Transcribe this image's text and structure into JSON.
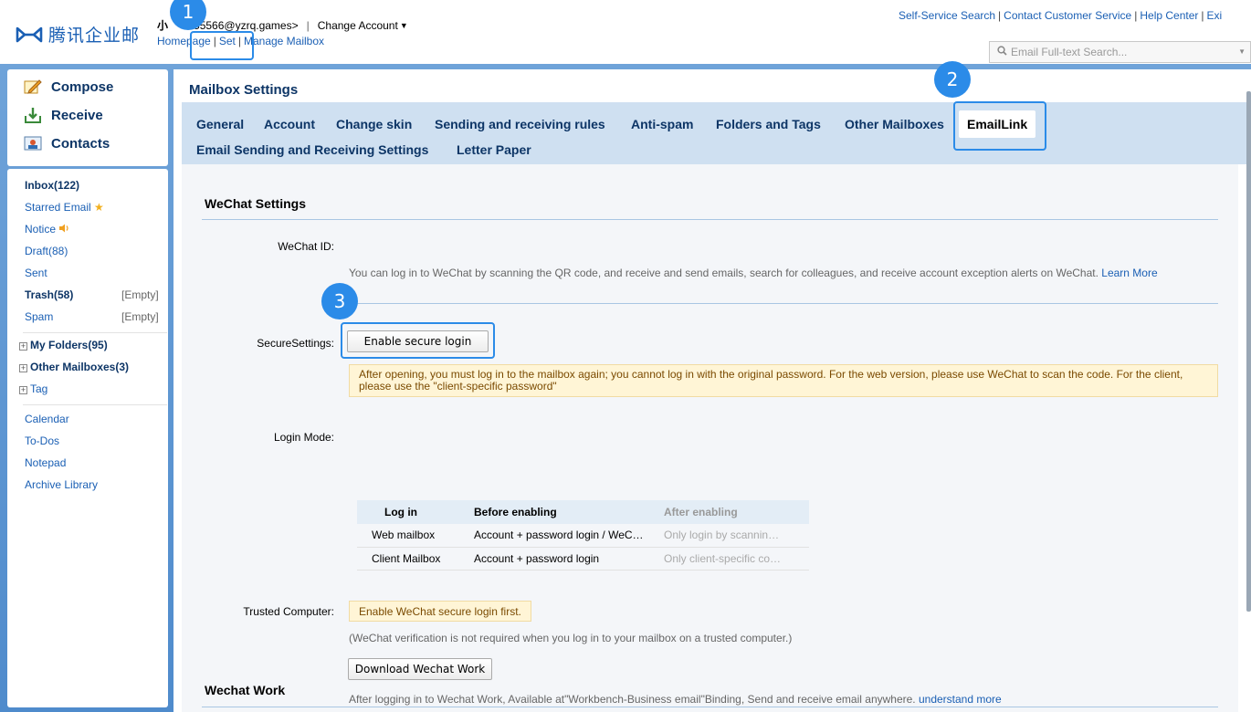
{
  "header": {
    "logo_text": "腾讯企业邮",
    "username": "小",
    "email": "55566@yzrq.games>",
    "change_account": "Change Account",
    "nav": [
      "Homepage",
      "Set",
      "Manage Mailbox"
    ],
    "top_links": [
      "Self-Service Search",
      "Contact Customer Service",
      "Help Center",
      "Exi"
    ],
    "search_placeholder": "Email Full-text Search..."
  },
  "sidebar": {
    "actions": [
      {
        "label": "Compose",
        "icon": "compose-icon"
      },
      {
        "label": "Receive",
        "icon": "receive-icon"
      },
      {
        "label": "Contacts",
        "icon": "contacts-icon"
      }
    ],
    "folders": [
      {
        "label": "Inbox(122)"
      },
      {
        "label": "Starred Email"
      },
      {
        "label": "Notice"
      },
      {
        "label": "Draft(88)"
      },
      {
        "label": "Sent"
      },
      {
        "label": "Trash(58)",
        "extra": "[Empty]"
      },
      {
        "label": "Spam",
        "extra": "[Empty]"
      }
    ],
    "groups": [
      "My Folders(95)",
      "Other Mailboxes(3)",
      "Tag"
    ],
    "tools": [
      "Calendar",
      "To-Dos",
      "Notepad",
      "Archive Library"
    ]
  },
  "main": {
    "title": "Mailbox Settings",
    "tabs_row1": [
      "General",
      "Account",
      "Change skin",
      "Sending and receiving rules",
      "Anti-spam",
      "Folders and Tags",
      "Other Mailboxes",
      "EmailLink"
    ],
    "tabs_row2": [
      "Email Sending and Receiving Settings",
      "Letter Paper"
    ],
    "active_tab": "EmailLink"
  },
  "wechat": {
    "heading": "WeChat Settings",
    "id_label": "WeChat ID:",
    "id_desc": "You can log in to WeChat by scanning the QR code, and receive and send emails, search for colleagues, and receive account exception alerts on WeChat.",
    "learn_more": "Learn More",
    "secure_label": "SecureSettings:",
    "secure_button": "Enable secure login",
    "secure_notice": "After opening, you must log in to the mailbox again; you cannot log in with the original password. For the web version, please use WeChat to scan the code. For the client, please use the \"client-specific password\"",
    "login_mode_label": "Login Mode:",
    "login_table": {
      "headers": [
        "Log in",
        "Before enabling",
        "After enabling"
      ],
      "rows": [
        [
          "Web mailbox",
          "Account + password login / WeC…",
          "Only login by scannin…"
        ],
        [
          "Client Mailbox",
          "Account + password login",
          "Only client-specific co…"
        ]
      ]
    },
    "trusted_label": "Trusted Computer:",
    "trusted_notice": "Enable WeChat secure login first.",
    "trusted_desc": "(WeChat verification is not required when you log in to your mailbox on a trusted computer.)"
  },
  "work": {
    "heading": "Wechat Work",
    "download_button": "Download Wechat Work",
    "desc": "After logging in to Wechat Work, Available at\"Workbench-Business email\"Binding, Send and receive email anywhere.",
    "understand_more": "understand more"
  },
  "annotations": [
    "1",
    "2",
    "3"
  ],
  "colors": {
    "accent": "#2b8be8",
    "link": "#1a5fb4",
    "heading": "#0d3566"
  }
}
